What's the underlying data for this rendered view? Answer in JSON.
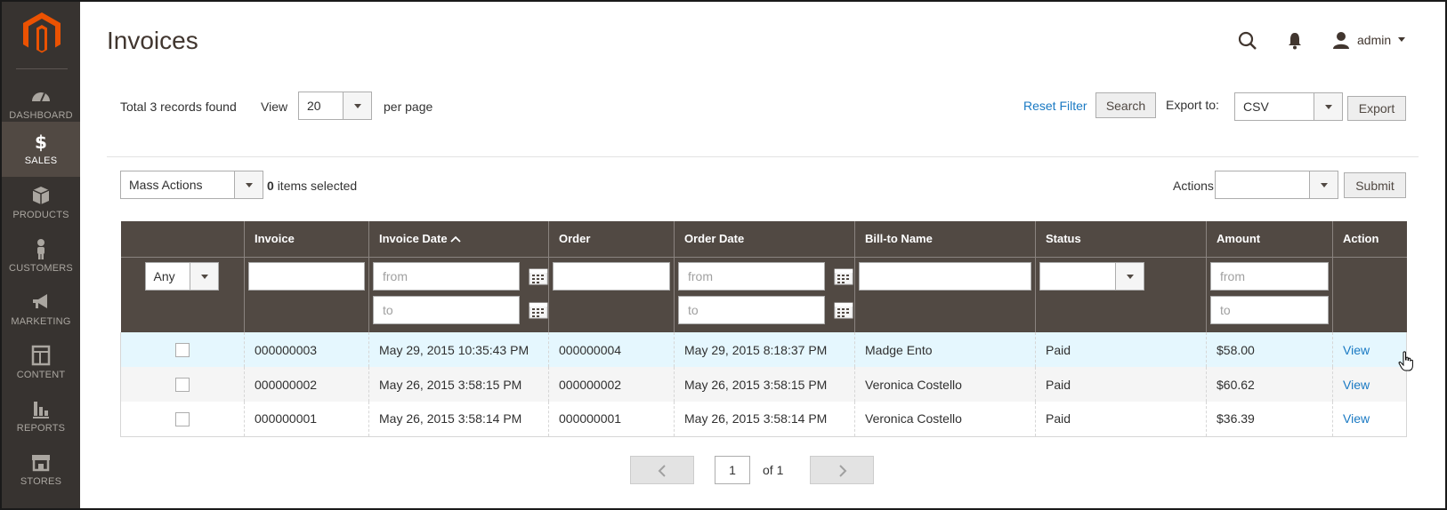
{
  "sidebar": {
    "items": [
      {
        "label": "DASHBOARD",
        "icon": "dashboard-icon"
      },
      {
        "label": "SALES",
        "icon": "dollar-icon",
        "active": true
      },
      {
        "label": "PRODUCTS",
        "icon": "box-icon"
      },
      {
        "label": "CUSTOMERS",
        "icon": "person-icon"
      },
      {
        "label": "MARKETING",
        "icon": "megaphone-icon"
      },
      {
        "label": "CONTENT",
        "icon": "layout-icon"
      },
      {
        "label": "REPORTS",
        "icon": "bar-chart-icon"
      },
      {
        "label": "STORES",
        "icon": "store-icon"
      }
    ]
  },
  "header": {
    "title": "Invoices",
    "user": "admin"
  },
  "toolbar": {
    "records_text": "Total 3 records found",
    "view_label": "View",
    "per_page_value": "20",
    "per_page_label": "per page",
    "reset_filter": "Reset Filter",
    "search_button": "Search",
    "export_label": "Export to:",
    "export_format": "CSV",
    "export_button": "Export"
  },
  "mass_actions": {
    "label": "Mass Actions",
    "selected_count": "0",
    "selected_text": "items selected",
    "actions_label": "Actions",
    "actions_value": "",
    "submit_button": "Submit"
  },
  "grid": {
    "columns": [
      "",
      "Invoice",
      "Invoice Date",
      "Order",
      "Order Date",
      "Bill-to Name",
      "Status",
      "Amount",
      "Action"
    ],
    "sort_column": "Invoice Date",
    "filters": {
      "select_any": "Any",
      "from_placeholder": "from",
      "to_placeholder": "to"
    },
    "rows": [
      {
        "invoice": "000000003",
        "invoice_date": "May 29, 2015 10:35:43 PM",
        "order": "000000004",
        "order_date": "May 29, 2015 8:18:37 PM",
        "bill_to": "Madge Ento",
        "status": "Paid",
        "amount": "$58.00",
        "action": "View"
      },
      {
        "invoice": "000000002",
        "invoice_date": "May 26, 2015 3:58:15 PM",
        "order": "000000002",
        "order_date": "May 26, 2015 3:58:15 PM",
        "bill_to": "Veronica Costello",
        "status": "Paid",
        "amount": "$60.62",
        "action": "View"
      },
      {
        "invoice": "000000001",
        "invoice_date": "May 26, 2015 3:58:14 PM",
        "order": "000000001",
        "order_date": "May 26, 2015 3:58:14 PM",
        "bill_to": "Veronica Costello",
        "status": "Paid",
        "amount": "$36.39",
        "action": "View"
      }
    ]
  },
  "pager": {
    "current": "1",
    "of_text": "of 1"
  },
  "colors": {
    "sidebar_bg": "#373330",
    "sidebar_active": "#514943",
    "grid_header": "#514943",
    "logo": "#eb5202",
    "link": "#1979c3",
    "row_hover": "#e5f7fe"
  }
}
